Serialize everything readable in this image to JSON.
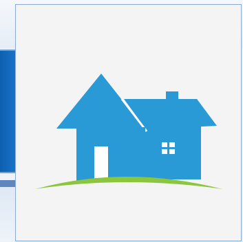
{
  "logo": {
    "icon": "house-logo-icon",
    "primary_color": "#2a9ad6",
    "ground_color": "#8cc63f",
    "window_color": "#ffffff"
  },
  "background": {
    "banner_color": "#1566b8",
    "page_color": "#eef2f8"
  }
}
